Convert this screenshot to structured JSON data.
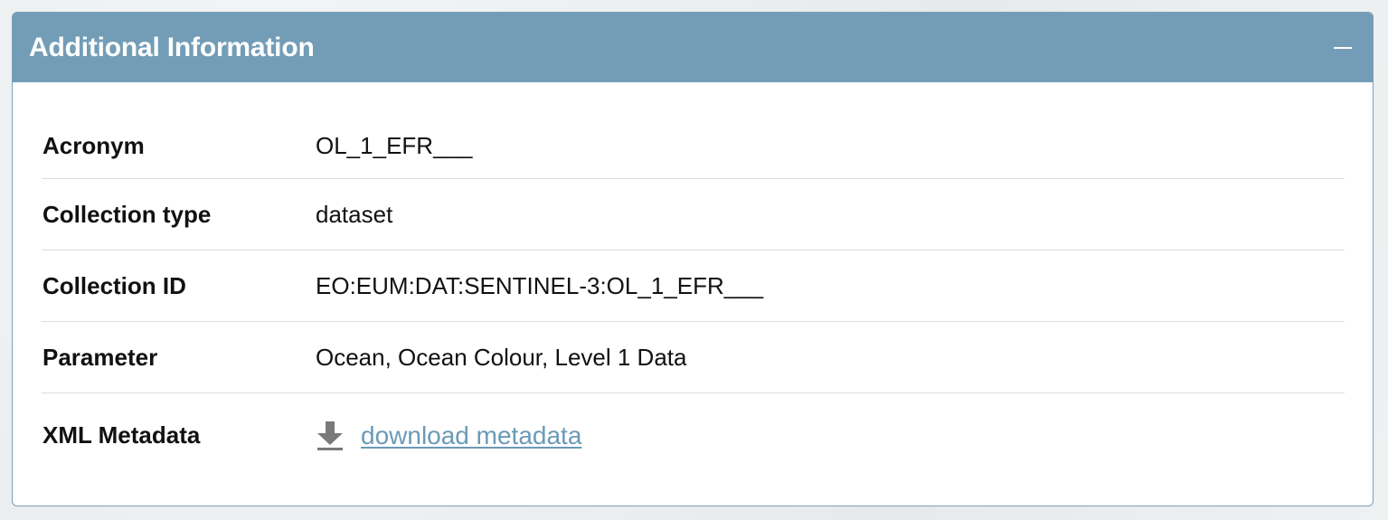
{
  "panel": {
    "title": "Additional Information",
    "collapse_icon": "minus-icon"
  },
  "rows": [
    {
      "label": "Acronym",
      "value": "OL_1_EFR___"
    },
    {
      "label": "Collection type",
      "value": "dataset"
    },
    {
      "label": "Collection ID",
      "value": "EO:EUM:DAT:SENTINEL-3:OL_1_EFR___"
    },
    {
      "label": "Parameter",
      "value": "Ocean, Ocean Colour, Level 1 Data"
    },
    {
      "label": "XML Metadata",
      "link_text": "download metadata",
      "icon": "download-icon"
    }
  ],
  "colors": {
    "header_bg": "#739db7",
    "link": "#6b9ab6",
    "border": "#7aa0b8"
  }
}
